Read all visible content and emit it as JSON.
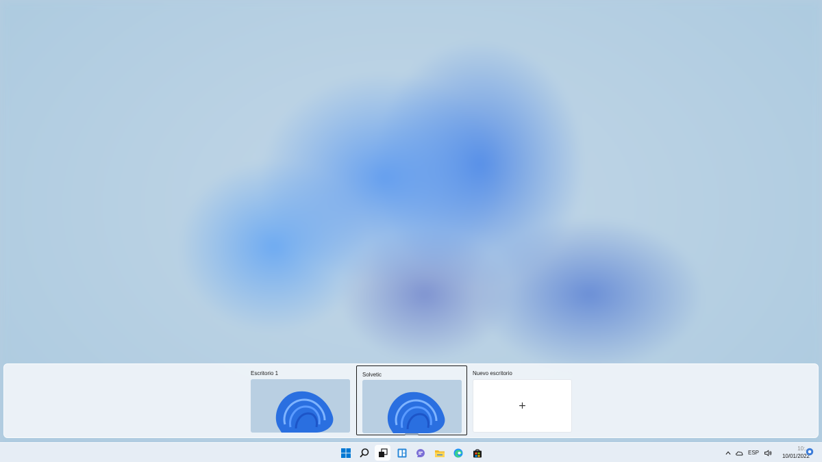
{
  "task_view": {
    "desktops": [
      {
        "label": "Escritorio 1"
      },
      {
        "label": "Solvetic"
      }
    ],
    "new_desktop": {
      "label": "Nuevo escritorio",
      "plus": "+"
    }
  },
  "taskbar": {
    "icons": [
      "windows-start-icon",
      "search-icon",
      "task-view-icon",
      "widgets-icon",
      "teams-chat-icon",
      "file-explorer-icon",
      "edge-icon",
      "store-icon"
    ],
    "tray": {
      "language": "ESP",
      "time": "10:...",
      "date": "10/01/2022"
    }
  },
  "colors": {
    "accent": "#0067c0",
    "taskbar_bg": "#e8eef6",
    "strip_bg": "#f0f4f9"
  }
}
